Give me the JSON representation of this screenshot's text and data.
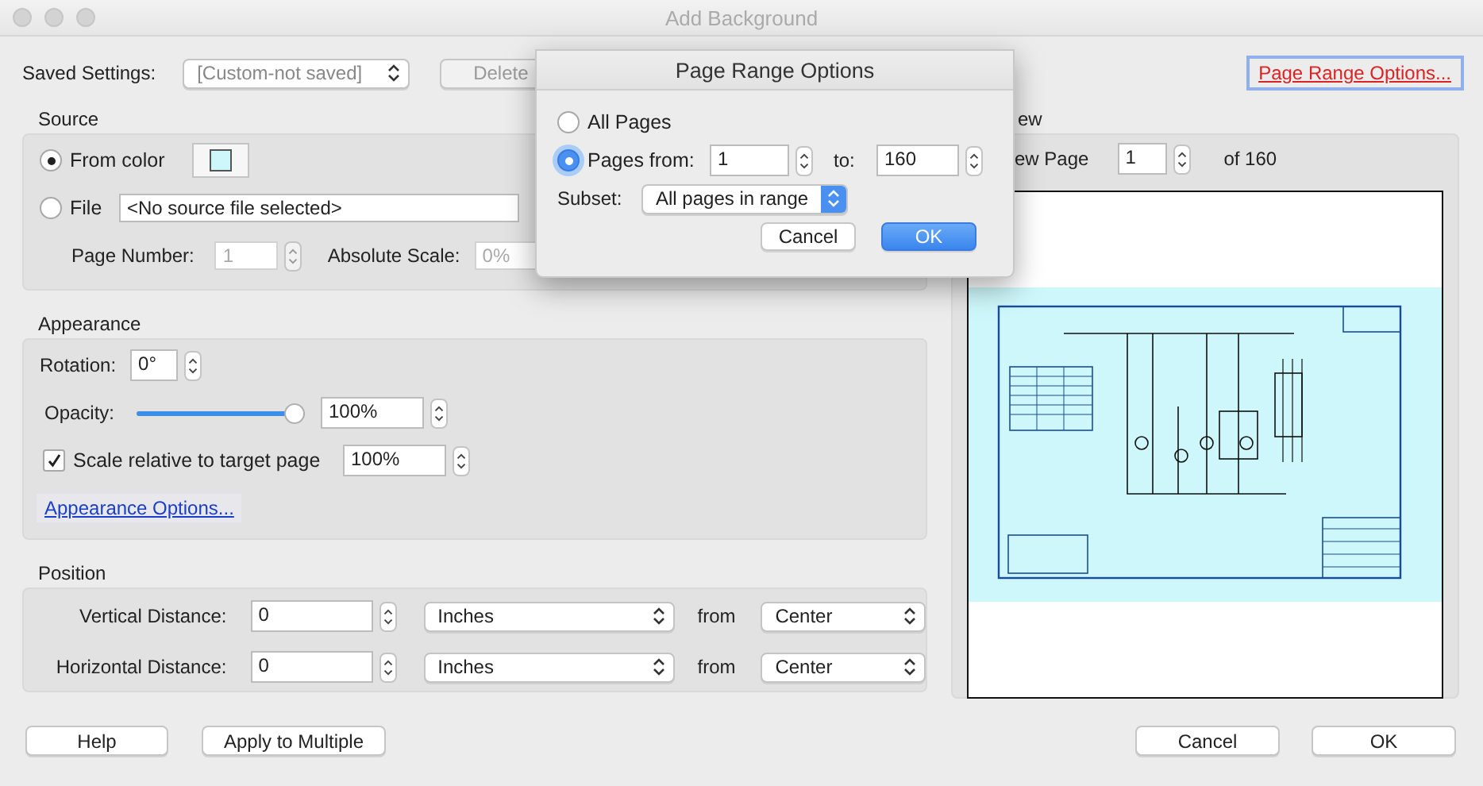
{
  "window": {
    "title": "Add Background"
  },
  "saved_settings": {
    "label": "Saved Settings:",
    "value": "[Custom-not saved]",
    "delete_button": "Delete"
  },
  "page_range_link": "Page Range Options...",
  "source": {
    "heading": "Source",
    "options": [
      {
        "label": "From color",
        "selected": true
      },
      {
        "label": "File",
        "selected": false
      }
    ],
    "color": "#cdf7fa",
    "file_value": "<No source file selected>",
    "page_number_label": "Page Number:",
    "page_number": "1",
    "absolute_scale_label": "Absolute Scale:",
    "absolute_scale": "0%"
  },
  "appearance": {
    "heading": "Appearance",
    "rotation_label": "Rotation:",
    "rotation": "0°",
    "opacity_label": "Opacity:",
    "opacity": {
      "level": 1
    },
    "opacity_value": "100%",
    "scale_relative": {
      "label": "Scale relative to target page",
      "checked": true,
      "value": "100%"
    },
    "options_link": "Appearance Options..."
  },
  "position": {
    "heading": "Position",
    "rows": [
      {
        "label": "Vertical Distance:",
        "value": "0",
        "unit": "Inches",
        "from_label": "from",
        "from": "Center"
      },
      {
        "label": "Horizontal Distance:",
        "value": "0",
        "unit": "Inches",
        "from_label": "from",
        "from": "Center"
      }
    ]
  },
  "preview": {
    "heading": "ew",
    "page_label": "ew Page",
    "page": "1",
    "of": "of 160"
  },
  "buttons": {
    "help": "Help",
    "apply": "Apply to Multiple",
    "cancel": "Cancel",
    "ok": "OK"
  },
  "page_range_sheet": {
    "title": "Page Range Options",
    "options": [
      {
        "label": "All Pages",
        "selected": false
      },
      {
        "label": "Pages from:",
        "selected": true
      }
    ],
    "from": "1",
    "to_label": "to:",
    "to": "160",
    "subset_label": "Subset:",
    "subset": "All pages in range",
    "cancel": "Cancel",
    "ok": "OK"
  }
}
